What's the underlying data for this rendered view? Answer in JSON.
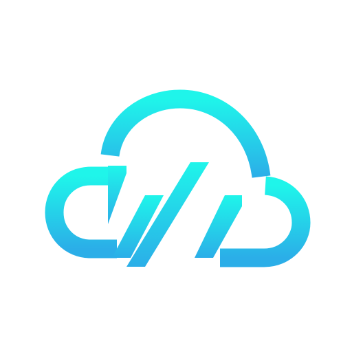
{
  "logo": {
    "icon": "cloud-rain-logo-icon",
    "gradient_top": "#1FF5EA",
    "gradient_bottom": "#2BAEE8",
    "background": "#FFFFFF"
  }
}
